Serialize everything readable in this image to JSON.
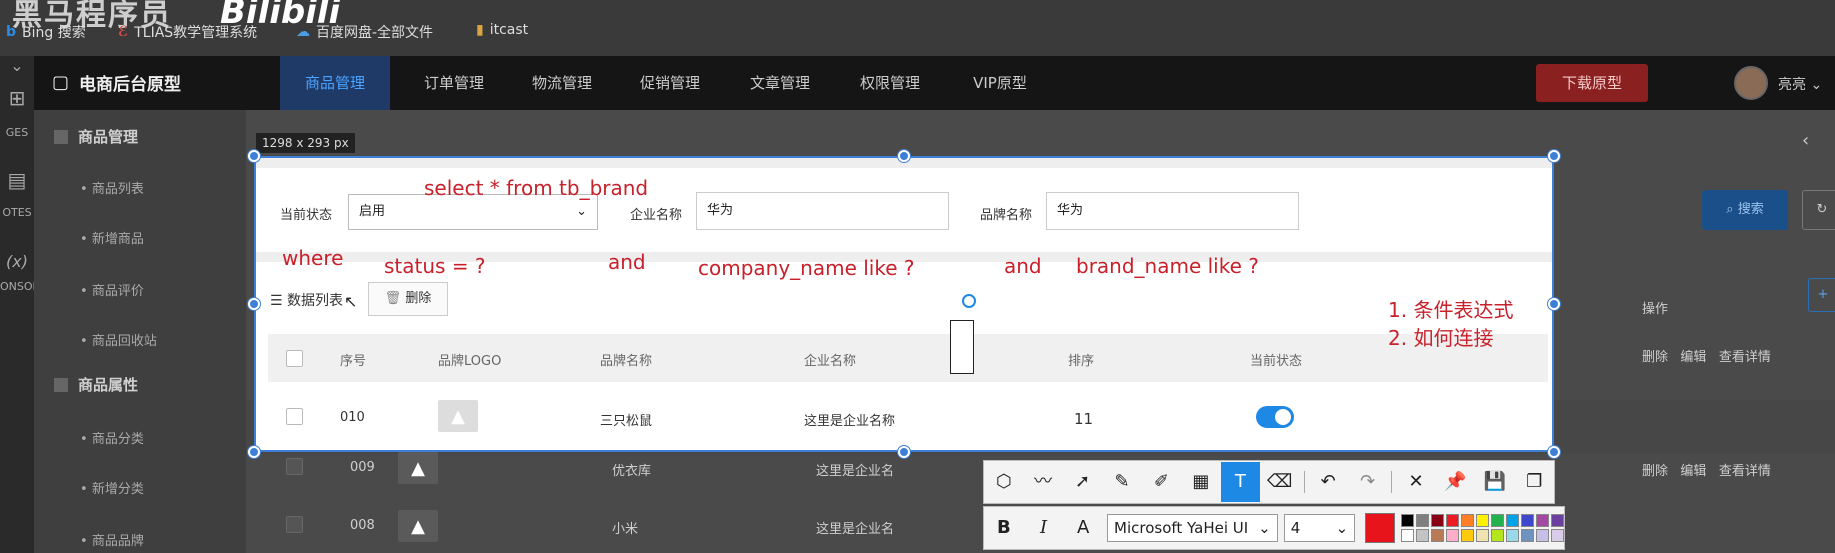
{
  "watermark": {
    "text": "黑马程序员",
    "logo": "Bilibili"
  },
  "bookmarks": [
    {
      "label": "Bing 搜索",
      "icon": "b"
    },
    {
      "label": "TLIAS教学管理系统",
      "icon": "ℰ"
    },
    {
      "label": "百度网盘-全部文件",
      "icon": "☁"
    },
    {
      "label": "itcast",
      "icon": "▮"
    }
  ],
  "rail": {
    "items": [
      "GES",
      "OTES",
      "(x)",
      "ONSOL"
    ]
  },
  "app": {
    "brand": "电商后台原型",
    "nav": [
      "商品管理",
      "订单管理",
      "物流管理",
      "促销管理",
      "文章管理",
      "权限管理",
      "VIP原型"
    ],
    "download": "下载原型",
    "user": "亮亮"
  },
  "sidebar": {
    "sections": [
      {
        "title": "商品管理",
        "items": [
          "商品列表",
          "新增商品",
          "商品评价",
          "商品回收站"
        ]
      },
      {
        "title": "商品属性",
        "items": [
          "商品分类",
          "新增分类",
          "商品品牌"
        ]
      }
    ]
  },
  "background": {
    "search_button": "搜索",
    "rows": [
      {
        "seq": "009",
        "brand": "优衣库",
        "company": "这里是企业名",
        "ops": [
          "删除",
          "编辑",
          "查看详情"
        ]
      },
      {
        "seq": "008",
        "brand": "小米",
        "company": "这里是企业名",
        "ops": [
          "删除",
          "编辑",
          "查看详情"
        ]
      }
    ],
    "first_row_ops": [
      "删除",
      "编辑",
      "查看详情"
    ],
    "ops_header": "操作"
  },
  "capture": {
    "size_tag": "1298 x 293 px",
    "filters": {
      "status_label": "当前状态",
      "status_value": "启用",
      "company_label": "企业名称",
      "company_value": "华为",
      "brand_label": "品牌名称",
      "brand_value": "华为"
    },
    "list_title": "数据列表",
    "delete_button": "删除",
    "table": {
      "headers": [
        "序号",
        "品牌LOGO",
        "品牌名称",
        "企业名称",
        "排序",
        "当前状态"
      ],
      "row": {
        "seq": "010",
        "brand": "三只松鼠",
        "company": "这里是企业名称",
        "order": "11",
        "status_on": true
      }
    }
  },
  "annotations": {
    "select": "select * from tb_brand",
    "where": "where",
    "status": "status = ?",
    "and1": "and",
    "company": "company_name like ?",
    "and2": "and",
    "brand": "brand_name like ?",
    "note1": "1. 条件表达式",
    "note2": "2. 如何连接"
  },
  "toolbar": {
    "font_name": "Microsoft YaHei UI",
    "font_size": "4",
    "current_color": "#e8141c",
    "palette": [
      "#000000",
      "#7f7f7f",
      "#880015",
      "#ed1c24",
      "#ff7f27",
      "#fff200",
      "#22b14c",
      "#00a2e8",
      "#3f48cc",
      "#a349a4",
      "#6b3fa0",
      "#ffffff",
      "#c3c3c3",
      "#b97a57",
      "#ffaec9",
      "#ffc90e",
      "#efe4b0",
      "#b5e61d",
      "#99d9ea",
      "#7092be",
      "#c8bfe7",
      "#d8cce8"
    ]
  }
}
